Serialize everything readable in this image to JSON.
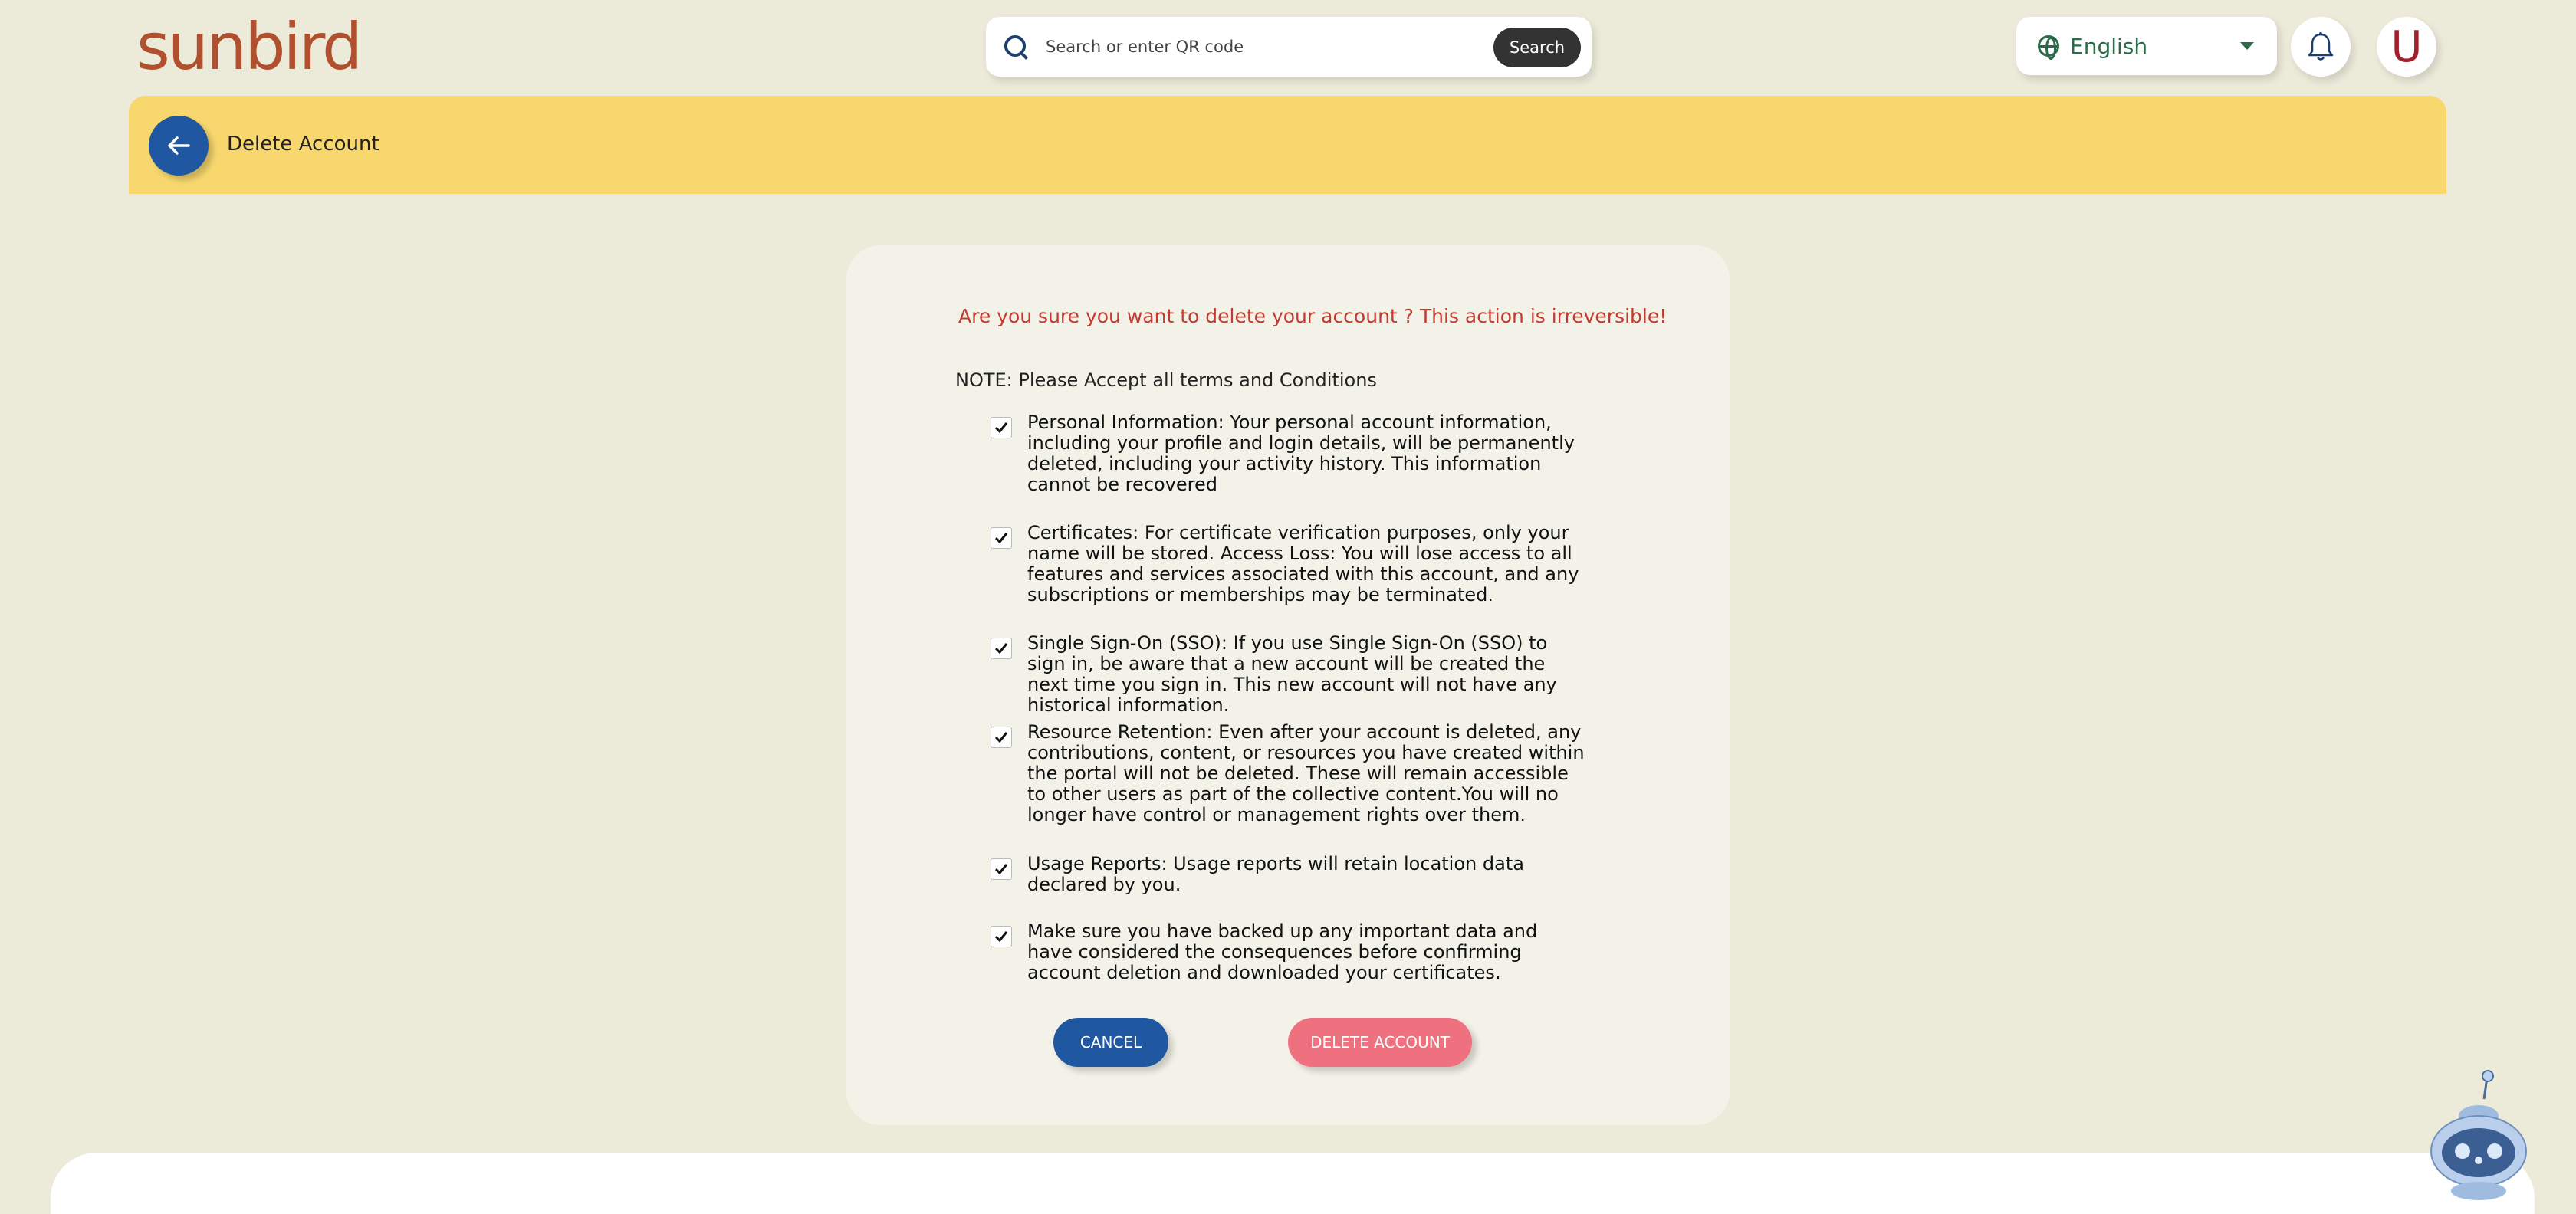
{
  "header": {
    "logo_text": "sunbird",
    "search": {
      "placeholder": "Search or enter QR code",
      "button_label": "Search"
    },
    "language": {
      "selected": "English"
    },
    "avatar_initial": "U"
  },
  "banner": {
    "title": "Delete Account"
  },
  "dialog": {
    "warning": "Are you sure you want to delete your account ? This action is irreversible!",
    "note": "NOTE: Please Accept all terms and Conditions",
    "terms": [
      {
        "text": "Personal Information: Your personal account information, including your profile and login details, will be permanently deleted, including your activity history. This information cannot be recovered",
        "checked": true
      },
      {
        "text": "Certificates: For certificate verification purposes, only your name will be stored. Access Loss: You will lose access to all features and services associated with this account, and any subscriptions or memberships may be terminated.",
        "checked": true
      },
      {
        "text": "Single Sign-On (SSO): If you use Single Sign-On (SSO) to sign in, be aware that a new account will be created the next time you sign in. This new account will not have any historical information.",
        "checked": true
      },
      {
        "text": "Resource Retention: Even after your account is deleted, any contributions, content, or resources you have created within the portal will not be deleted. These will remain accessible to other users as part of the collective content.You will no longer have control or management rights over them.",
        "checked": true
      },
      {
        "text": "Usage Reports: Usage reports will retain location data declared by you.",
        "checked": true
      },
      {
        "text": "Make sure you have backed up any important data and have considered the consequences before confirming account deletion and downloaded your certificates.",
        "checked": true
      }
    ],
    "cancel_label": "CANCEL",
    "delete_label": "DELETE ACCOUNT"
  },
  "colors": {
    "background": "#ecead9",
    "banner": "#f8d86e",
    "primary": "#1f57a0",
    "delete": "#ef7180",
    "warning": "#c43a2f",
    "brand": "#b0502e"
  }
}
